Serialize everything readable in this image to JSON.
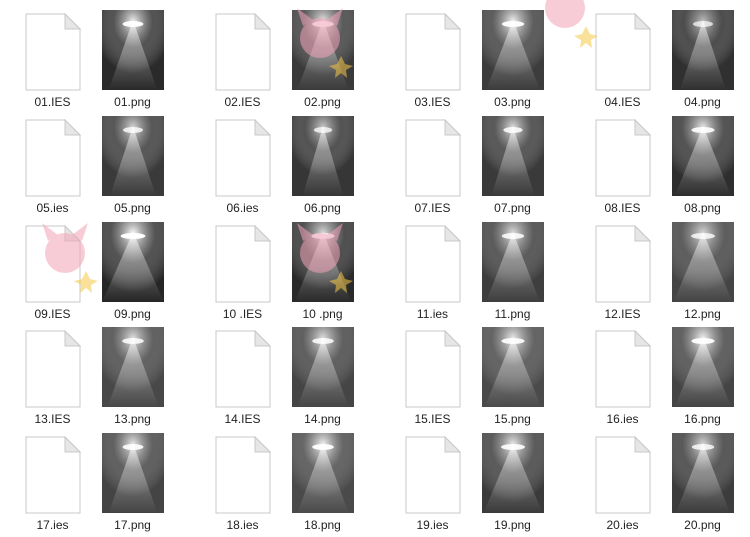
{
  "files": [
    {
      "name": "01.IES",
      "type": "ies"
    },
    {
      "name": "01.png",
      "type": "png",
      "bright": 0.95,
      "spread": 0.55,
      "bg": "#2a2a2a"
    },
    {
      "name": "02.IES",
      "type": "ies"
    },
    {
      "name": "02.png",
      "type": "png",
      "bright": 0.9,
      "spread": 0.6,
      "bg": "#3a3a3a"
    },
    {
      "name": "03.IES",
      "type": "ies"
    },
    {
      "name": "03.png",
      "type": "png",
      "bright": 0.95,
      "spread": 0.65,
      "bg": "#3c3c3c"
    },
    {
      "name": "04.IES",
      "type": "ies"
    },
    {
      "name": "04.png",
      "type": "png",
      "bright": 0.7,
      "spread": 0.5,
      "bg": "#303030"
    },
    {
      "name": "05.ies",
      "type": "ies"
    },
    {
      "name": "05.png",
      "type": "png",
      "bright": 0.8,
      "spread": 0.5,
      "bg": "#3a3a3a"
    },
    {
      "name": "06.ies",
      "type": "ies"
    },
    {
      "name": "06.png",
      "type": "png",
      "bright": 0.75,
      "spread": 0.4,
      "bg": "#363636"
    },
    {
      "name": "07.IES",
      "type": "ies"
    },
    {
      "name": "07.png",
      "type": "png",
      "bright": 0.85,
      "spread": 0.45,
      "bg": "#3a3a3a"
    },
    {
      "name": "08.IES",
      "type": "ies"
    },
    {
      "name": "08.png",
      "type": "png",
      "bright": 0.9,
      "spread": 0.7,
      "bg": "#2e2e2e"
    },
    {
      "name": "09.IES",
      "type": "ies"
    },
    {
      "name": "09.png",
      "type": "png",
      "bright": 1.0,
      "spread": 0.8,
      "bg": "#262626"
    },
    {
      "name": "10 .IES",
      "type": "ies"
    },
    {
      "name": "10 .png",
      "type": "png",
      "bright": 0.85,
      "spread": 0.7,
      "bg": "#2a2a2a"
    },
    {
      "name": "11.ies",
      "type": "ies"
    },
    {
      "name": "11.png",
      "type": "png",
      "bright": 0.85,
      "spread": 0.65,
      "bg": "#3e3e3e"
    },
    {
      "name": "12.IES",
      "type": "ies"
    },
    {
      "name": "12.png",
      "type": "png",
      "bright": 0.8,
      "spread": 0.75,
      "bg": "#444444"
    },
    {
      "name": "13.IES",
      "type": "ies"
    },
    {
      "name": "13.png",
      "type": "png",
      "bright": 0.85,
      "spread": 0.6,
      "bg": "#484848"
    },
    {
      "name": "14.IES",
      "type": "ies"
    },
    {
      "name": "14.png",
      "type": "png",
      "bright": 0.85,
      "spread": 0.6,
      "bg": "#454545"
    },
    {
      "name": "15.IES",
      "type": "ies"
    },
    {
      "name": "15.png",
      "type": "png",
      "bright": 0.9,
      "spread": 0.7,
      "bg": "#4a4a4a"
    },
    {
      "name": "16.ies",
      "type": "ies"
    },
    {
      "name": "16.png",
      "type": "png",
      "bright": 0.95,
      "spread": 0.7,
      "bg": "#444444"
    },
    {
      "name": "17.ies",
      "type": "ies"
    },
    {
      "name": "17.png",
      "type": "png",
      "bright": 0.9,
      "spread": 0.55,
      "bg": "#444444"
    },
    {
      "name": "18.ies",
      "type": "ies"
    },
    {
      "name": "18.png",
      "type": "png",
      "bright": 0.95,
      "spread": 0.6,
      "bg": "#4a4a4a"
    },
    {
      "name": "19.ies",
      "type": "ies"
    },
    {
      "name": "19.png",
      "type": "png",
      "bright": 0.9,
      "spread": 0.75,
      "bg": "#3a3a3a"
    },
    {
      "name": "20.ies",
      "type": "ies"
    },
    {
      "name": "20.png",
      "type": "png",
      "bright": 0.8,
      "spread": 0.65,
      "bg": "#3c3c3c"
    }
  ],
  "colors": {
    "doc_fill": "#ffffff",
    "doc_stroke": "#c8c8c8",
    "doc_fold": "#e6e6e6",
    "label": "#222222",
    "watermark_pink": "#f2a3b8",
    "watermark_yellow": "#f7c948"
  }
}
